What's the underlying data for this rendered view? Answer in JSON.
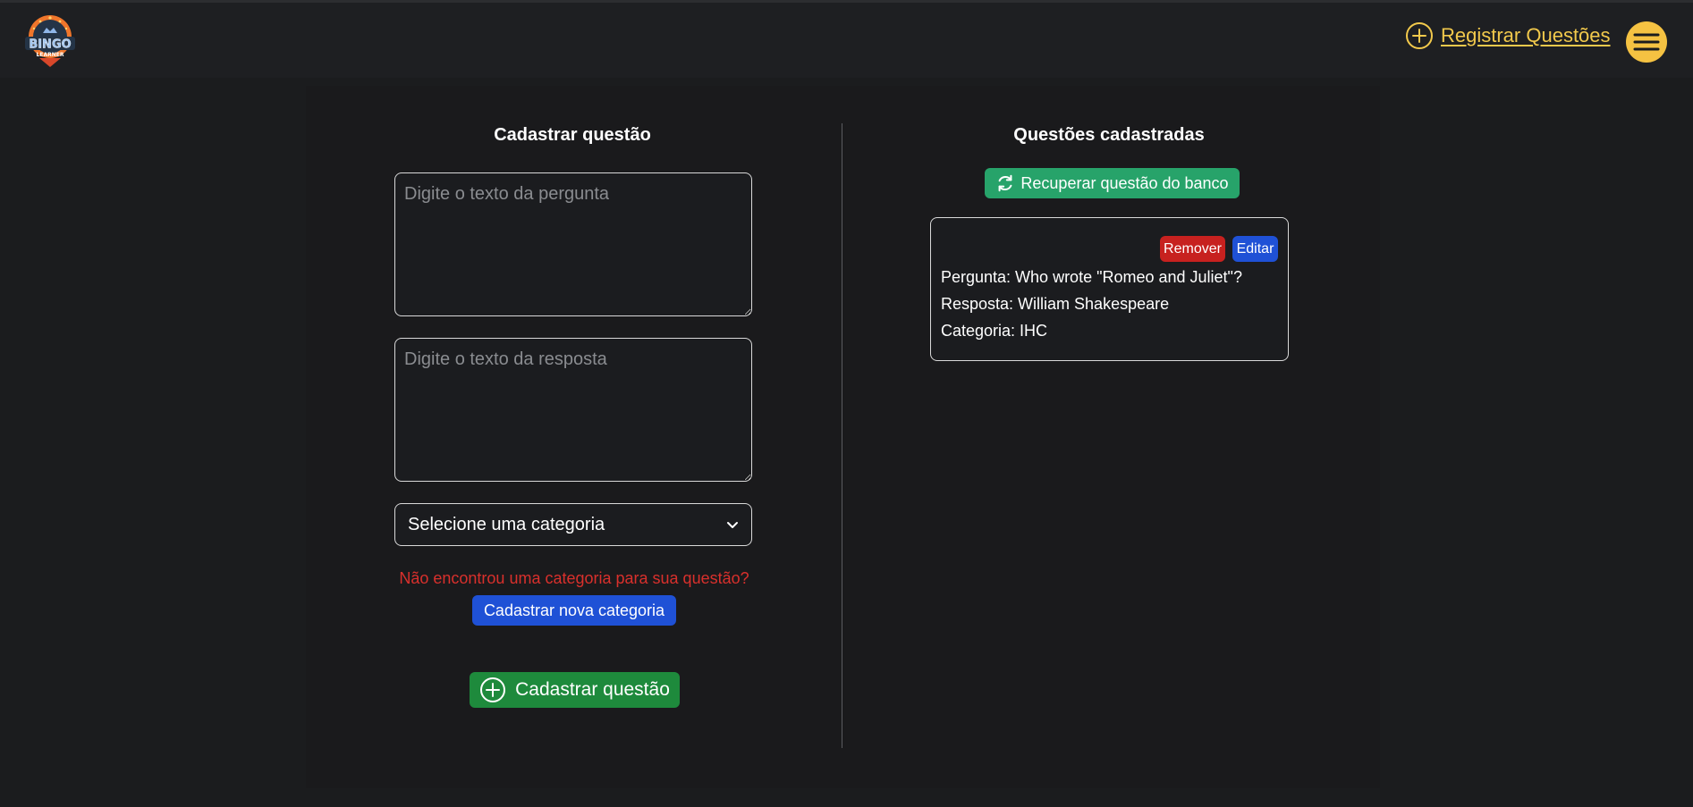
{
  "header": {
    "logo": {
      "brand_text": "BINGO",
      "sub_text": "LEARNER"
    },
    "register_link": {
      "label": "Registrar Questões",
      "icon": "plus-circle-icon"
    },
    "menu_button": {
      "icon": "hamburger-menu-icon"
    }
  },
  "form": {
    "title": "Cadastrar questão",
    "question_placeholder": "Digite o texto da pergunta",
    "question_value": "",
    "answer_placeholder": "Digite o texto da resposta",
    "answer_value": "",
    "category_select": {
      "selected": "Selecione uma categoria",
      "icon": "chevron-down-icon"
    },
    "missing_category_text": "Não encontrou uma categoria para sua questão?",
    "new_category_button": "Cadastrar nova categoria",
    "submit_button": {
      "label": "Cadastrar questão",
      "icon": "plus-circle-icon"
    }
  },
  "questions": {
    "title": "Questões cadastradas",
    "recover_button": {
      "label": "Recuperar questão do banco",
      "icon": "refresh-icon"
    },
    "items": [
      {
        "question": "Pergunta: Who wrote \"Romeo and Juliet\"?",
        "answer": "Resposta: William Shakespeare",
        "category": "Categoria: IHC",
        "remove_label": "Remover",
        "edit_label": "Editar"
      }
    ]
  },
  "colors": {
    "accent_yellow": "#f5c242",
    "success_green": "#1e8a3c",
    "recover_green": "#27a36a",
    "primary_blue": "#1f51d6",
    "danger_red": "#c7211f",
    "warning_text_red": "#d9302c",
    "background": "#1b1c1e"
  }
}
